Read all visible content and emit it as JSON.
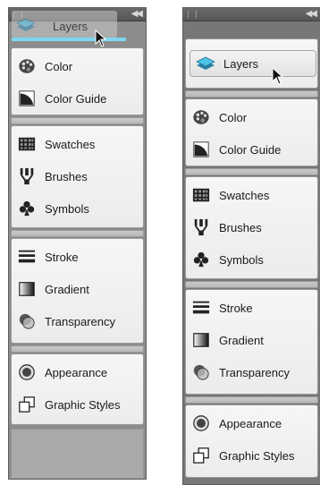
{
  "left_panel": {
    "dragged_item_label": "Layers",
    "groups": [
      {
        "items": [
          {
            "label": "Color",
            "icon": "color-palette-icon"
          },
          {
            "label": "Color Guide",
            "icon": "color-guide-icon"
          }
        ]
      },
      {
        "items": [
          {
            "label": "Swatches",
            "icon": "swatches-grid-icon"
          },
          {
            "label": "Brushes",
            "icon": "brushes-icon"
          },
          {
            "label": "Symbols",
            "icon": "club-symbol-icon"
          }
        ]
      },
      {
        "items": [
          {
            "label": "Stroke",
            "icon": "stroke-lines-icon"
          },
          {
            "label": "Gradient",
            "icon": "gradient-icon"
          },
          {
            "label": "Transparency",
            "icon": "transparency-icon"
          }
        ]
      },
      {
        "items": [
          {
            "label": "Appearance",
            "icon": "appearance-icon"
          },
          {
            "label": "Graphic Styles",
            "icon": "graphic-styles-icon"
          }
        ]
      }
    ]
  },
  "right_panel": {
    "top_item_label": "Layers",
    "groups": [
      {
        "items": [
          {
            "label": "Color",
            "icon": "color-palette-icon"
          },
          {
            "label": "Color Guide",
            "icon": "color-guide-icon"
          }
        ]
      },
      {
        "items": [
          {
            "label": "Swatches",
            "icon": "swatches-grid-icon"
          },
          {
            "label": "Brushes",
            "icon": "brushes-icon"
          },
          {
            "label": "Symbols",
            "icon": "club-symbol-icon"
          }
        ]
      },
      {
        "items": [
          {
            "label": "Stroke",
            "icon": "stroke-lines-icon"
          },
          {
            "label": "Gradient",
            "icon": "gradient-icon"
          },
          {
            "label": "Transparency",
            "icon": "transparency-icon"
          }
        ]
      },
      {
        "items": [
          {
            "label": "Appearance",
            "icon": "appearance-icon"
          },
          {
            "label": "Graphic Styles",
            "icon": "graphic-styles-icon"
          }
        ]
      }
    ]
  },
  "colors": {
    "highlight": "#7fd6f0",
    "panel_bg": "#f0f0f0",
    "dock_bg": "#8c8c8c"
  }
}
